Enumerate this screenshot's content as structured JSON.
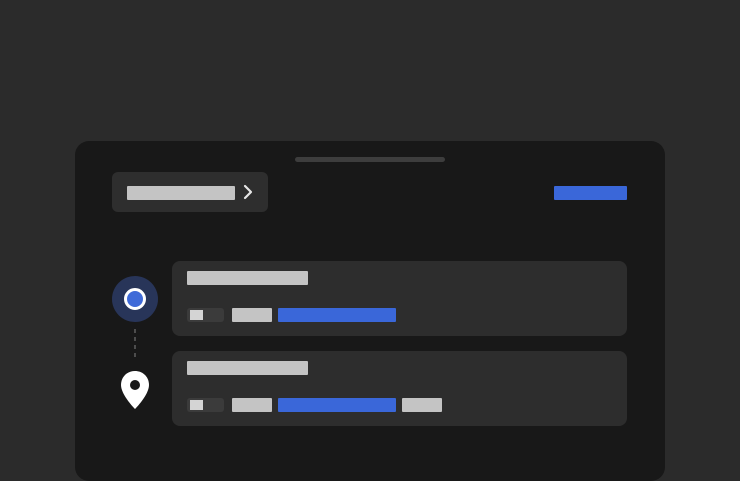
{
  "sheet": {
    "header": {
      "title": "",
      "action": ""
    },
    "origin": {
      "title": "",
      "detail": ""
    },
    "destination": {
      "title": "",
      "detail": ""
    }
  },
  "colors": {
    "background": "#2b2b2b",
    "sheet": "#181818",
    "card": "#2d2d2d",
    "accent": "#3a67d9",
    "origin_marker": "#283559",
    "placeholder_text": "#c4c4c4"
  },
  "icons": {
    "header_chevron": "chevron-right-icon",
    "origin_marker": "origin-dot-icon",
    "destination_marker": "location-pin-icon",
    "transit_mode": "transit-icon"
  }
}
